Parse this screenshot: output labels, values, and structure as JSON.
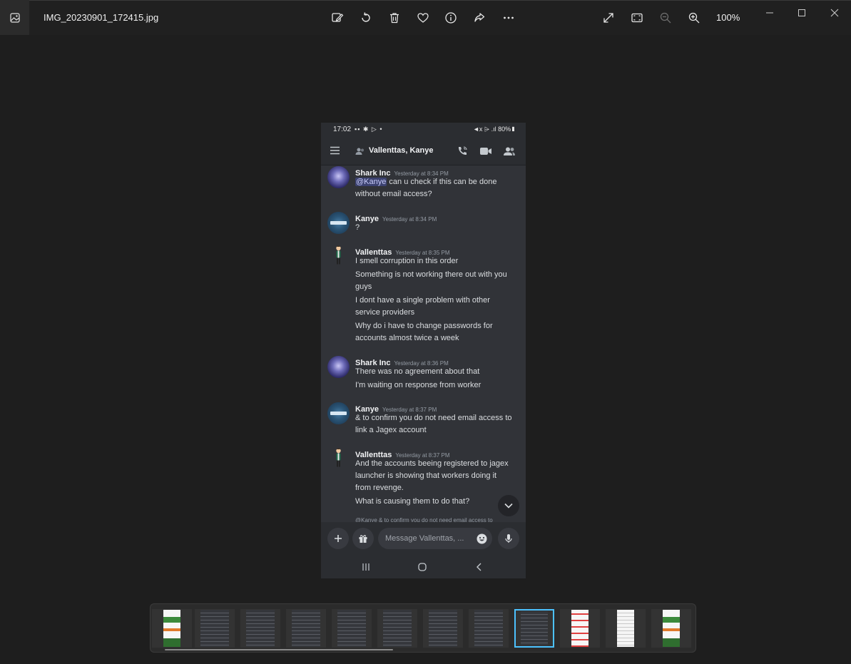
{
  "window": {
    "file_name": "IMG_20230901_172415.jpg",
    "zoom": "100%",
    "toolbar": {
      "edit_icon": "edit-image-icon",
      "rotate_icon": "rotate-icon",
      "delete_icon": "trash-icon",
      "favorite_icon": "heart-icon",
      "info_icon": "info-icon",
      "share_icon": "share-icon",
      "more_icon": "more-icon",
      "expand_icon": "expand-icon",
      "fit_icon": "fit-window-icon",
      "zoom_out_icon": "zoom-out-icon",
      "zoom_in_icon": "zoom-in-icon"
    }
  },
  "phone": {
    "status": {
      "time": "17:02",
      "icons": "▪▪ ✱ ▷ •",
      "right": "◄x ⩥ .ıl 80%▮"
    },
    "header": {
      "title": "Vallenttas, Kanye"
    },
    "messages": [
      {
        "author": "Shark Inc",
        "time": "Yesterday at 8:34 PM",
        "avatar": "shark",
        "lines": [
          {
            "mention": "@Kanye",
            "text": " can u check if this can be done"
          },
          {
            "text": "without email access?"
          }
        ]
      },
      {
        "author": "Kanye",
        "time": "Yesterday at 8:34 PM",
        "avatar": "kanye",
        "lines": [
          {
            "text": "?"
          }
        ]
      },
      {
        "author": "Vallenttas",
        "time": "Yesterday at 8:35 PM",
        "avatar": "vallenttas",
        "lines": [
          {
            "text": "I smell corruption in this order"
          },
          {
            "text": "Something is not working there out with you"
          },
          {
            "text": "guys"
          },
          {
            "text": "I dont have a single problem with other"
          },
          {
            "text": "service providers"
          },
          {
            "text": "Why do i have to change passwords for"
          },
          {
            "text": "accounts almost twice a week"
          }
        ]
      },
      {
        "author": "Shark Inc",
        "time": "Yesterday at 8:36 PM",
        "avatar": "shark",
        "lines": [
          {
            "text": "There was no agreement about that"
          },
          {
            "text": "I'm waiting on response from worker"
          }
        ]
      },
      {
        "author": "Kanye",
        "time": "Yesterday at 8:37 PM",
        "avatar": "kanye",
        "lines": [
          {
            "text": "& to confirm you do not need email access to"
          },
          {
            "text": "link a Jagex account"
          }
        ]
      },
      {
        "author": "Vallenttas",
        "time": "Yesterday at 8:37 PM",
        "avatar": "vallenttas",
        "lines": [
          {
            "text": "And the accounts beeing registered to jagex"
          },
          {
            "text": "launcher is showing that workers doing it"
          },
          {
            "text": "from revenge."
          },
          {
            "text": "What is causing them to do that?"
          }
        ]
      }
    ],
    "reply_peek": "@Kanye & to confirm you do not need email access to",
    "composer": {
      "placeholder": "Message Vallenttas, ..."
    }
  },
  "filmstrip": {
    "thumbnails": [
      {
        "style": "green",
        "active": false
      },
      {
        "style": "dark",
        "active": false
      },
      {
        "style": "dark",
        "active": false
      },
      {
        "style": "dark",
        "active": false
      },
      {
        "style": "dark",
        "active": false
      },
      {
        "style": "dark",
        "active": false
      },
      {
        "style": "dark",
        "active": false
      },
      {
        "style": "dark",
        "active": false
      },
      {
        "style": "dark",
        "active": true
      },
      {
        "style": "red",
        "active": false
      },
      {
        "style": "light",
        "active": false
      },
      {
        "style": "green",
        "active": false
      }
    ]
  }
}
